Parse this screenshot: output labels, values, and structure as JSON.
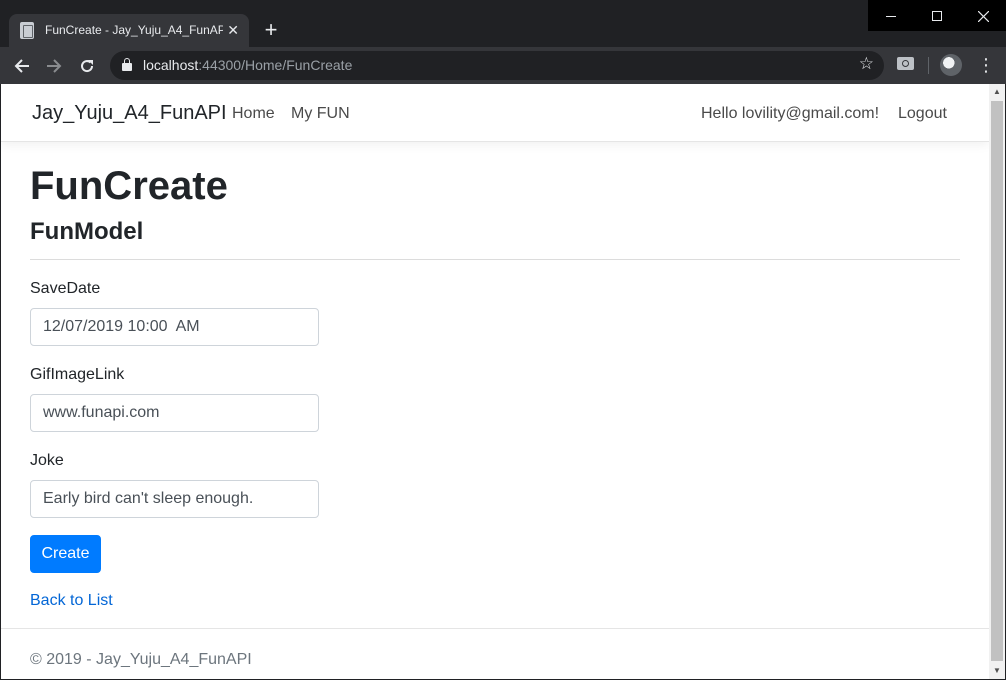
{
  "browser": {
    "tab_title": "FunCreate - Jay_Yuju_A4_FunAPI",
    "tab_close": "✕",
    "new_tab": "+",
    "url_host": "localhost",
    "url_rest": ":44300/Home/FunCreate"
  },
  "site": {
    "brand": "Jay_Yuju_A4_FunAPI",
    "nav": {
      "home": "Home",
      "my_fun": "My FUN",
      "greeting": "Hello lovility@gmail.com!",
      "logout": "Logout"
    }
  },
  "page": {
    "title": "FunCreate",
    "subtitle": "FunModel"
  },
  "form": {
    "save_date": {
      "label": "SaveDate",
      "value": "12/07/2019 10:00  AM"
    },
    "gif_image_link": {
      "label": "GifImageLink",
      "value": "www.funapi.com"
    },
    "joke": {
      "label": "Joke",
      "value": "Early bird can't sleep enough."
    },
    "submit_label": "Create",
    "back_link": "Back to List"
  },
  "footer": {
    "text": "© 2019 - Jay_Yuju_A4_FunAPI"
  },
  "icons": {
    "back": "arrow-left-icon",
    "forward": "arrow-right-icon",
    "reload": "reload-icon",
    "lock": "lock-icon",
    "star": "star-icon",
    "camera": "camera-icon",
    "menu": "kebab-menu-icon"
  },
  "colors": {
    "primary": "#007bff",
    "link": "#0366d6",
    "chrome_dark": "#202124"
  }
}
